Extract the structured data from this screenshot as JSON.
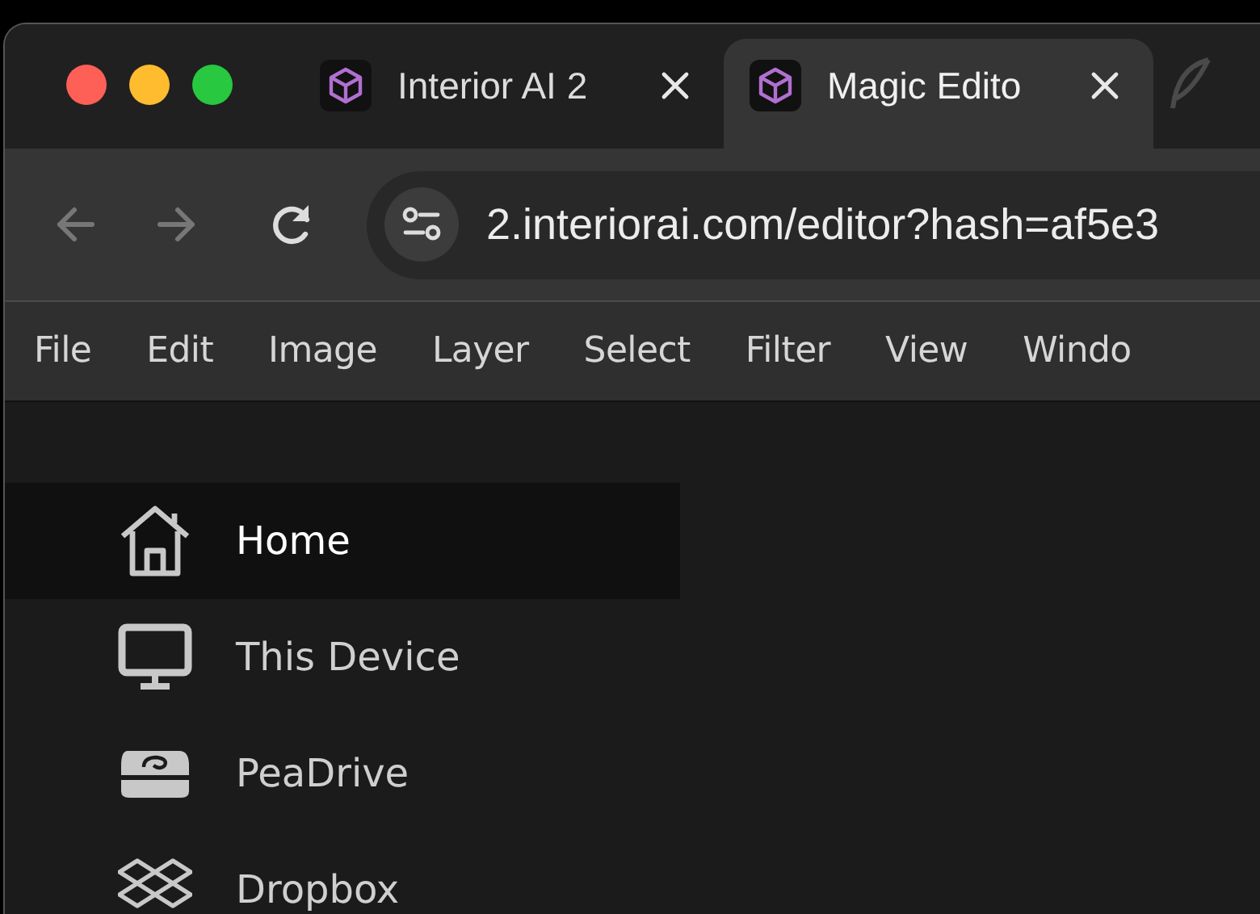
{
  "tabs": [
    {
      "title": "Interior AI 2",
      "selected": false
    },
    {
      "title": "Magic Edito",
      "selected": true
    }
  ],
  "toolbar": {
    "url": "2.interiorai.com/editor?hash=af5e3"
  },
  "menu": [
    "File",
    "Edit",
    "Image",
    "Layer",
    "Select",
    "Filter",
    "View",
    "Windo"
  ],
  "sidebar": {
    "items": [
      {
        "label": "Home",
        "kind": "home",
        "selected": true
      },
      {
        "label": "This Device",
        "kind": "device",
        "selected": false
      },
      {
        "label": "PeaDrive",
        "kind": "drive",
        "selected": false
      },
      {
        "label": "Dropbox",
        "kind": "dropbox",
        "selected": false
      }
    ]
  }
}
